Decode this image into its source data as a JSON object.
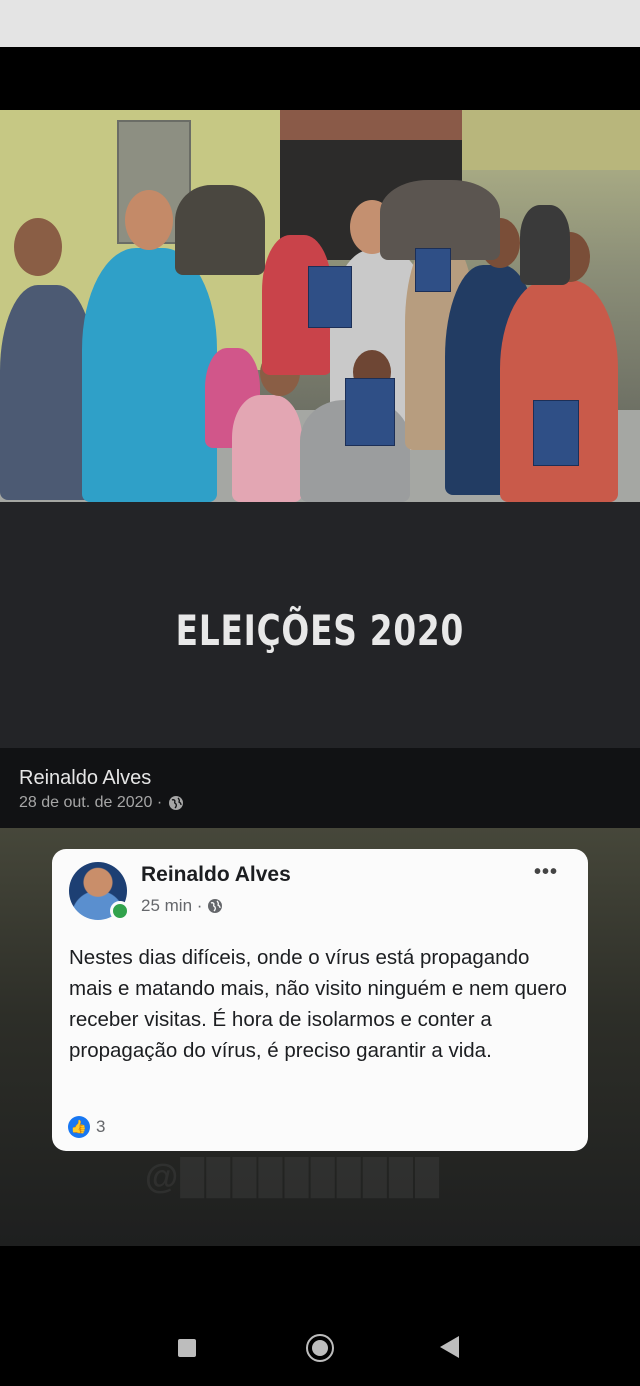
{
  "banner": {
    "title": "ELEIÇÕES 2020"
  },
  "post_header": {
    "author": "Reinaldo Alves",
    "date": "28 de out. de 2020 ·",
    "privacy_icon": "globe-icon"
  },
  "card": {
    "author": "Reinaldo Alves",
    "time": "25 min ·",
    "privacy_icon": "globe-icon",
    "more_icon": "•••",
    "text": "Nestes dias difíceis, onde o vírus está propagando mais e matando mais, não visito ninguém e nem quero receber visitas. É hora de isolarmos e conter a propagação do vírus, é preciso garantir a vida.",
    "like_count": "3",
    "like_icon": "👍",
    "online_color": "#31a24c",
    "accent": "#1877f2"
  },
  "navigation": {
    "recent_icon": "square-icon",
    "home_icon": "circle-icon",
    "back_icon": "triangle-icon"
  }
}
